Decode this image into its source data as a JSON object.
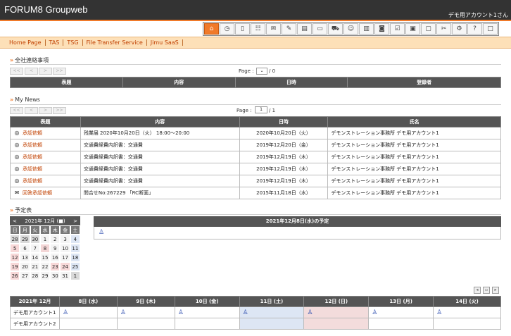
{
  "header": {
    "title": "FORUM8 Groupweb",
    "user": "デモ用アカウント1さん"
  },
  "toolbar": [
    "home-icon",
    "clock-icon",
    "door-icon",
    "org-icon",
    "mail-icon",
    "todo-icon",
    "doc-icon",
    "board-icon",
    "car-icon",
    "user-icon",
    "book-icon",
    "camera-icon",
    "survey-icon",
    "meeting-icon",
    "monitor-icon",
    "tools-icon",
    "settings-icon",
    "help-icon",
    "window-icon"
  ],
  "nav": [
    "Home Page",
    "TAS",
    "TSG",
    "File Transfer Service",
    "Jimu SaaS"
  ],
  "notices": {
    "title": "全社連絡事項",
    "pager": {
      "first": "<<",
      "prev": "<",
      "next": ">",
      "last": ">>",
      "label": "Page :",
      "total": "/ 0"
    },
    "headers": [
      "表題",
      "内容",
      "日時",
      "登録者"
    ]
  },
  "news": {
    "title": "My News",
    "pager": {
      "first": "<<",
      "prev": "<",
      "next": ">",
      "last": ">>",
      "label": "Page :",
      "current": "1",
      "total": "/ 1"
    },
    "headers": [
      "表題",
      "内容",
      "日時",
      "氏名"
    ],
    "rows": [
      {
        "type": "承認依頼",
        "content": "残業届 2020年10月20日（火） 18:00～20:00",
        "date": "2020年10月20日（火）",
        "name": "デモンストレーション事務所 デモ用アカウント1"
      },
      {
        "type": "承認依頼",
        "content": "交通費経費内訳書：交通費",
        "date": "2019年12月20日（金）",
        "name": "デモンストレーション事務所 デモ用アカウント1"
      },
      {
        "type": "承認依頼",
        "content": "交通費経費内訳書：交通費",
        "date": "2019年12月19日（木）",
        "name": "デモンストレーション事務所 デモ用アカウント1"
      },
      {
        "type": "承認依頼",
        "content": "交通費経費内訳書：交通費",
        "date": "2019年12月19日（木）",
        "name": "デモンストレーション事務所 デモ用アカウント1"
      },
      {
        "type": "承認依頼",
        "content": "交通費経費内訳書：交通費",
        "date": "2019年12月19日（木）",
        "name": "デモンストレーション事務所 デモ用アカウント1"
      },
      {
        "type": "回答承認依頼",
        "content": "問合せNo:267229 「RC断面」",
        "date": "2015年11月18日（水）",
        "name": "デモンストレーション事務所 デモ用アカウント1"
      }
    ]
  },
  "schedule": {
    "title": "予定表",
    "calendar": {
      "month": "2021年 12月",
      "prev": "<",
      "next": ">",
      "dow": [
        "日",
        "月",
        "火",
        "水",
        "木",
        "金",
        "土"
      ],
      "weeks": [
        [
          "28",
          "29",
          "30",
          "1",
          "2",
          "3",
          "4"
        ],
        [
          "5",
          "6",
          "7",
          "8",
          "9",
          "10",
          "11"
        ],
        [
          "12",
          "13",
          "14",
          "15",
          "16",
          "17",
          "18"
        ],
        [
          "19",
          "20",
          "21",
          "22",
          "23",
          "24",
          "25"
        ],
        [
          "26",
          "27",
          "28",
          "29",
          "30",
          "31",
          "1"
        ]
      ]
    },
    "day_title": "2021年12月8日(水)の予定",
    "week_headers": [
      "2021年 12月",
      "8日 (水)",
      "9日 (木)",
      "10日 (金)",
      "11日 (土)",
      "12日 (日)",
      "13日 (月)",
      "14日 (火)"
    ],
    "accounts": [
      "デモ用アカウント1",
      "デモ用アカウント2"
    ]
  }
}
